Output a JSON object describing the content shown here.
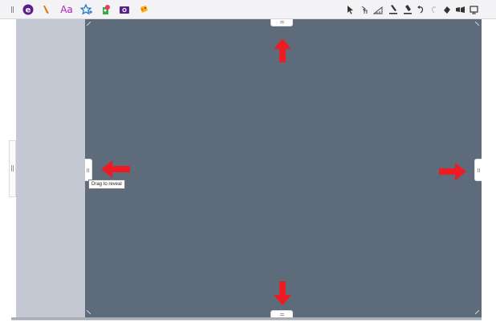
{
  "toolbar": {
    "left_tools": [
      {
        "name": "edge-logo-icon"
      },
      {
        "name": "highlighter-icon"
      },
      {
        "name": "font-icon",
        "label": "Aa"
      },
      {
        "name": "favorite-star-icon"
      },
      {
        "name": "sticker-icon"
      },
      {
        "name": "camera-icon"
      },
      {
        "name": "paint-icon"
      }
    ],
    "right_tools": [
      {
        "name": "select-pointer-icon"
      },
      {
        "name": "touch-select-icon"
      },
      {
        "name": "ruler-icon"
      },
      {
        "name": "pen-icon"
      },
      {
        "name": "marker-icon"
      },
      {
        "name": "undo-icon"
      },
      {
        "name": "redo-icon"
      },
      {
        "name": "eraser-icon"
      },
      {
        "name": "ink-effect-icon"
      },
      {
        "name": "present-icon"
      }
    ]
  },
  "handles": {
    "left_tooltip": "Drag to reveal"
  },
  "colors": {
    "canvas": "#5e6b7b",
    "sidebar": "#c4c8d2",
    "arrow": "#ec1c24",
    "accent_purple": "#5a1e8c",
    "accent_orange": "#e8720c"
  }
}
